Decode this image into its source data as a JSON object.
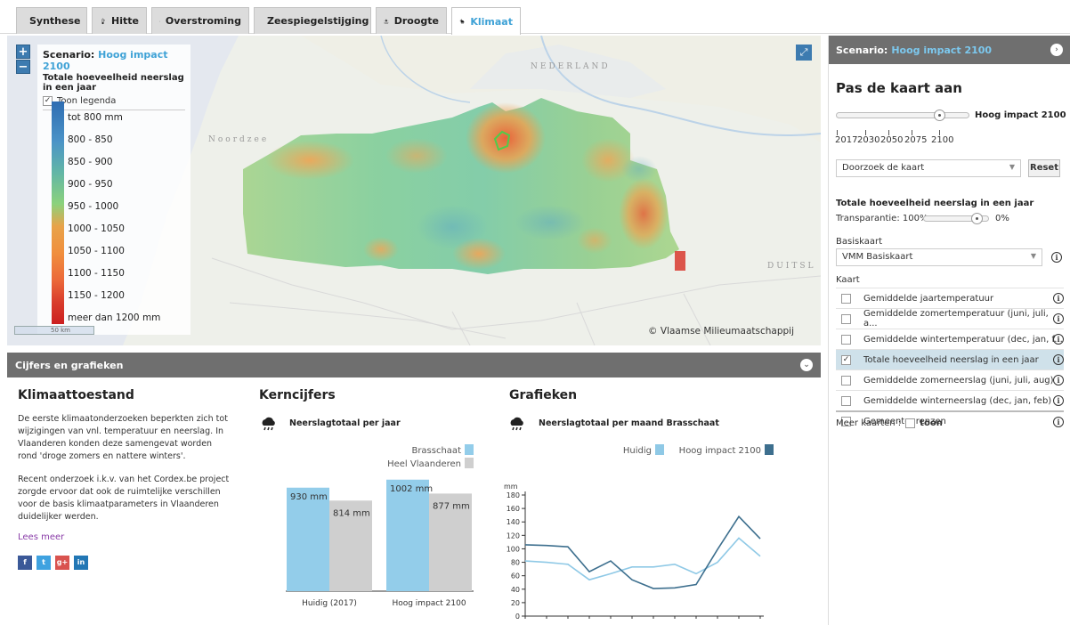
{
  "tabs": [
    {
      "label": "Synthese",
      "icon": "synthese-icon"
    },
    {
      "label": "Hitte",
      "icon": "thermometer-icon"
    },
    {
      "label": "Overstroming",
      "icon": "flood-icon"
    },
    {
      "label": "Zeespiegelstijging",
      "icon": "sea-level-icon"
    },
    {
      "label": "Droogte",
      "icon": "drought-icon"
    },
    {
      "label": "Klimaat",
      "icon": "climate-icon",
      "active": true
    }
  ],
  "map": {
    "scenario_label": "Scenario:",
    "scenario_value": "Hoog impact 2100",
    "subtitle": "Totale hoeveelheid neerslag in een jaar",
    "show_legend_label": "Toon legenda",
    "legend": [
      "tot 800 mm",
      "800 - 850",
      "850 - 900",
      "900 - 950",
      "950 - 1000",
      "1000 - 1050",
      "1050 - 1100",
      "1100 - 1150",
      "1150 - 1200",
      "meer dan 1200 mm"
    ],
    "scale_label": "50 km",
    "copyright": "© Vlaamse Milieumaatschappij",
    "labels": {
      "nederland": "NEDERLAND",
      "noordzee": "Noordzee",
      "duitsland": "DUITSL"
    },
    "zoom_in": "+",
    "zoom_out": "−"
  },
  "panel": {
    "scenario_label": "Scenario:",
    "scenario_value": "Hoog impact 2100",
    "title": "Pas de kaart aan",
    "slider_value_label": "Hoog impact 2100",
    "years": [
      "2017",
      "2030",
      "2050",
      "2075",
      "2100"
    ],
    "search_placeholder": "Doorzoek de kaart",
    "reset_label": "Reset",
    "layer_title": "Totale hoeveelheid neerslag in een jaar",
    "transparency_label": "Transparantie: 100%",
    "transparency_end": "0%",
    "basemap_label": "Basiskaart",
    "basemap_value": "VMM Basiskaart",
    "kaart_label": "Kaart",
    "layers": [
      {
        "label": "Gemiddelde jaartemperatuur",
        "checked": false
      },
      {
        "label": "Gemiddelde zomertemperatuur (juni, juli, a...",
        "checked": false
      },
      {
        "label": "Gemiddelde wintertemperatuur (dec, jan, f...",
        "checked": false
      },
      {
        "label": "Totale hoeveelheid neerslag in een jaar",
        "checked": true
      },
      {
        "label": "Gemiddelde zomerneerslag (juni, juli, aug)",
        "checked": false
      },
      {
        "label": "Gemiddelde winterneerslag (dec, jan, feb)",
        "checked": false
      },
      {
        "label": "Gemeentegrenzen",
        "checked": false
      }
    ],
    "more_maps_label": "Meer kaarten :",
    "more_maps_toggle": "toon"
  },
  "bottom": {
    "header": "Cijfers en grafieken",
    "klimaat": {
      "title": "Klimaattoestand",
      "p1": "De eerste klimaatonderzoeken beperkten zich tot wijzigingen van vnl. temperatuur en neerslag. In Vlaanderen konden deze samengevat worden rond 'droge zomers en nattere winters'.",
      "p2": "Recent onderzoek i.k.v. van het Cordex.be project zorgde ervoor dat ook de ruimtelijke verschillen voor de basis klimaatparameters in Vlaanderen duidelijker werden.",
      "read_more": "Lees meer",
      "social": [
        "f",
        "t",
        "g+",
        "in"
      ]
    },
    "kerncijfers": {
      "title": "Kerncijfers",
      "subtitle": "Neerslagtotaal per jaar"
    },
    "grafieken": {
      "title": "Grafieken",
      "subtitle": "Neerslagtotaal per maand Brasschaat"
    }
  },
  "colors": {
    "accent": "#3fa2d6",
    "header_gray": "#6f6f6f",
    "bar_light": "#93cdea",
    "bar_gray": "#cfcfcf",
    "line_dark": "#3d6f8e",
    "line_light": "#8fc9e6"
  },
  "chart_data": [
    {
      "type": "bar",
      "categories": [
        "Huidig (2017)",
        "Hoog impact 2100"
      ],
      "series": [
        {
          "name": "Brasschaat",
          "values": [
            930,
            1002
          ],
          "labels": [
            "930 mm",
            "1002 mm"
          ]
        },
        {
          "name": "Heel Vlaanderen",
          "values": [
            814,
            877
          ],
          "labels": [
            "814 mm",
            "877 mm"
          ]
        }
      ],
      "ylim": [
        0,
        1200
      ],
      "legend_position": "top-right"
    },
    {
      "type": "line",
      "x": [
        1,
        2,
        3,
        4,
        5,
        6,
        7,
        8,
        9,
        10,
        11,
        12
      ],
      "series": [
        {
          "name": "Huidig",
          "values": [
            82,
            80,
            77,
            54,
            63,
            73,
            73,
            77,
            63,
            80,
            116,
            89
          ]
        },
        {
          "name": "Hoog impact 2100",
          "values": [
            106,
            105,
            103,
            66,
            82,
            54,
            41,
            42,
            47,
            99,
            148,
            115
          ]
        }
      ],
      "ylabel": "mm",
      "yticks": [
        "0",
        "20",
        "40",
        "60",
        "80",
        "100",
        "120",
        "140",
        "160",
        "180"
      ],
      "ylim": [
        0,
        180
      ],
      "legend_position": "top-right"
    }
  ]
}
